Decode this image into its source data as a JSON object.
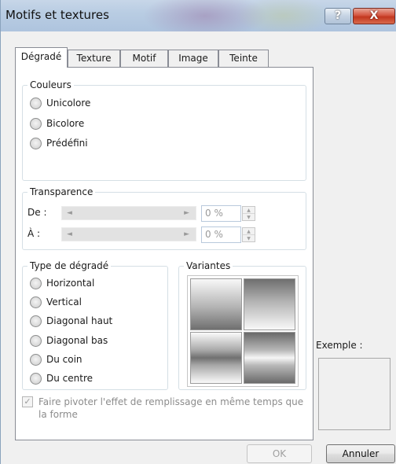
{
  "window": {
    "title": "Motifs et textures",
    "help_glyph": "?",
    "close_glyph": "X"
  },
  "tabs": [
    {
      "label": "Dégradé",
      "active": true
    },
    {
      "label": "Texture",
      "active": false
    },
    {
      "label": "Motif",
      "active": false
    },
    {
      "label": "Image",
      "active": false
    },
    {
      "label": "Teinte",
      "active": false
    }
  ],
  "couleurs": {
    "label": "Couleurs",
    "options": [
      {
        "label": "Unicolore"
      },
      {
        "label": "Bicolore"
      },
      {
        "label": "Prédéfini"
      }
    ]
  },
  "transparence": {
    "label": "Transparence",
    "de_label": "De :",
    "a_label": "À :",
    "de_value": "0 %",
    "a_value": "0 %"
  },
  "type_degrade": {
    "label": "Type de dégradé",
    "options": [
      {
        "label": "Horizontal"
      },
      {
        "label": "Vertical"
      },
      {
        "label": "Diagonal haut"
      },
      {
        "label": "Diagonal bas"
      },
      {
        "label": "Du coin"
      },
      {
        "label": "Du centre"
      }
    ]
  },
  "variantes": {
    "label": "Variantes"
  },
  "rotate_checkbox": {
    "label": "Faire pivoter l'effet de remplissage en même temps que la forme",
    "checked": true
  },
  "exemple": {
    "label": "Exemple :"
  },
  "buttons": {
    "ok": "OK",
    "cancel": "Annuler"
  },
  "icons": {
    "slider_left": "◄",
    "slider_right": "►",
    "spin_up": "▲",
    "spin_down": "▼",
    "check": "✓"
  },
  "colors": {
    "title_bar": "#b9cde3",
    "close_button": "#c2371f",
    "panel": "#ffffff",
    "dialog": "#f0f0f0"
  }
}
